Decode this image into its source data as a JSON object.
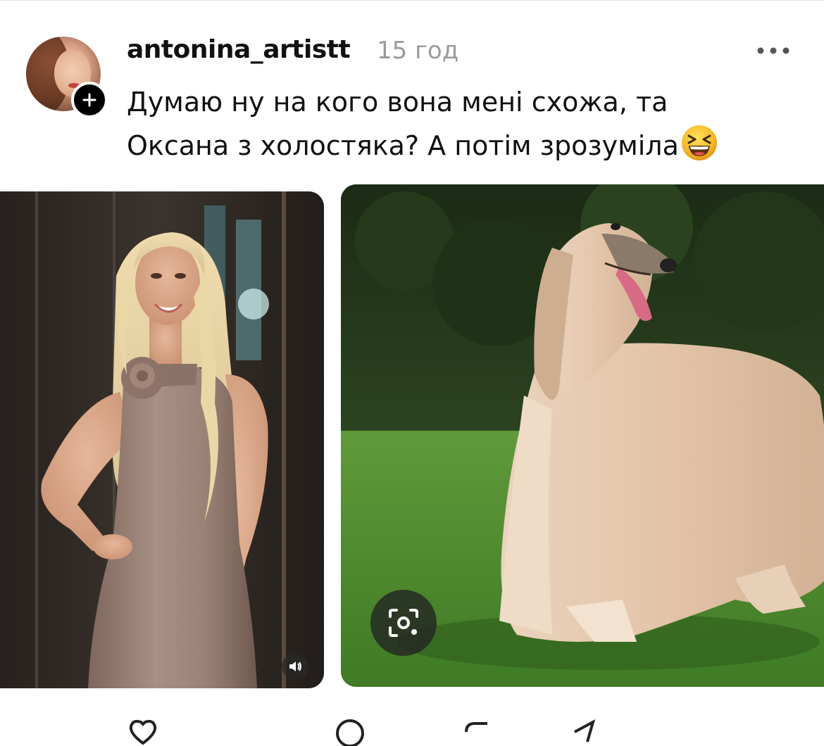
{
  "post": {
    "username": "antonina_artistt",
    "timestamp": "15 год",
    "caption_line1": "Думаю ну на кого вона мені схожа, та",
    "caption_line2": "Оксана з холостяка? А потім зрозуміла",
    "caption_emoji": "grinning-squinting-face-emoji"
  },
  "media": {
    "left_image": "woman-in-satin-dress-photo",
    "right_image": "afghan-hound-dog-photo",
    "left_overlay_icon": "speaker-icon",
    "right_overlay_icon": "visual-search-icon"
  },
  "actions": {
    "icons": [
      "heart-icon",
      "comment-icon",
      "repost-icon",
      "share-icon"
    ]
  },
  "colors": {
    "text": "#111111",
    "muted": "#9a9a9a",
    "follow_badge": "#000000",
    "background": "#ffffff"
  }
}
